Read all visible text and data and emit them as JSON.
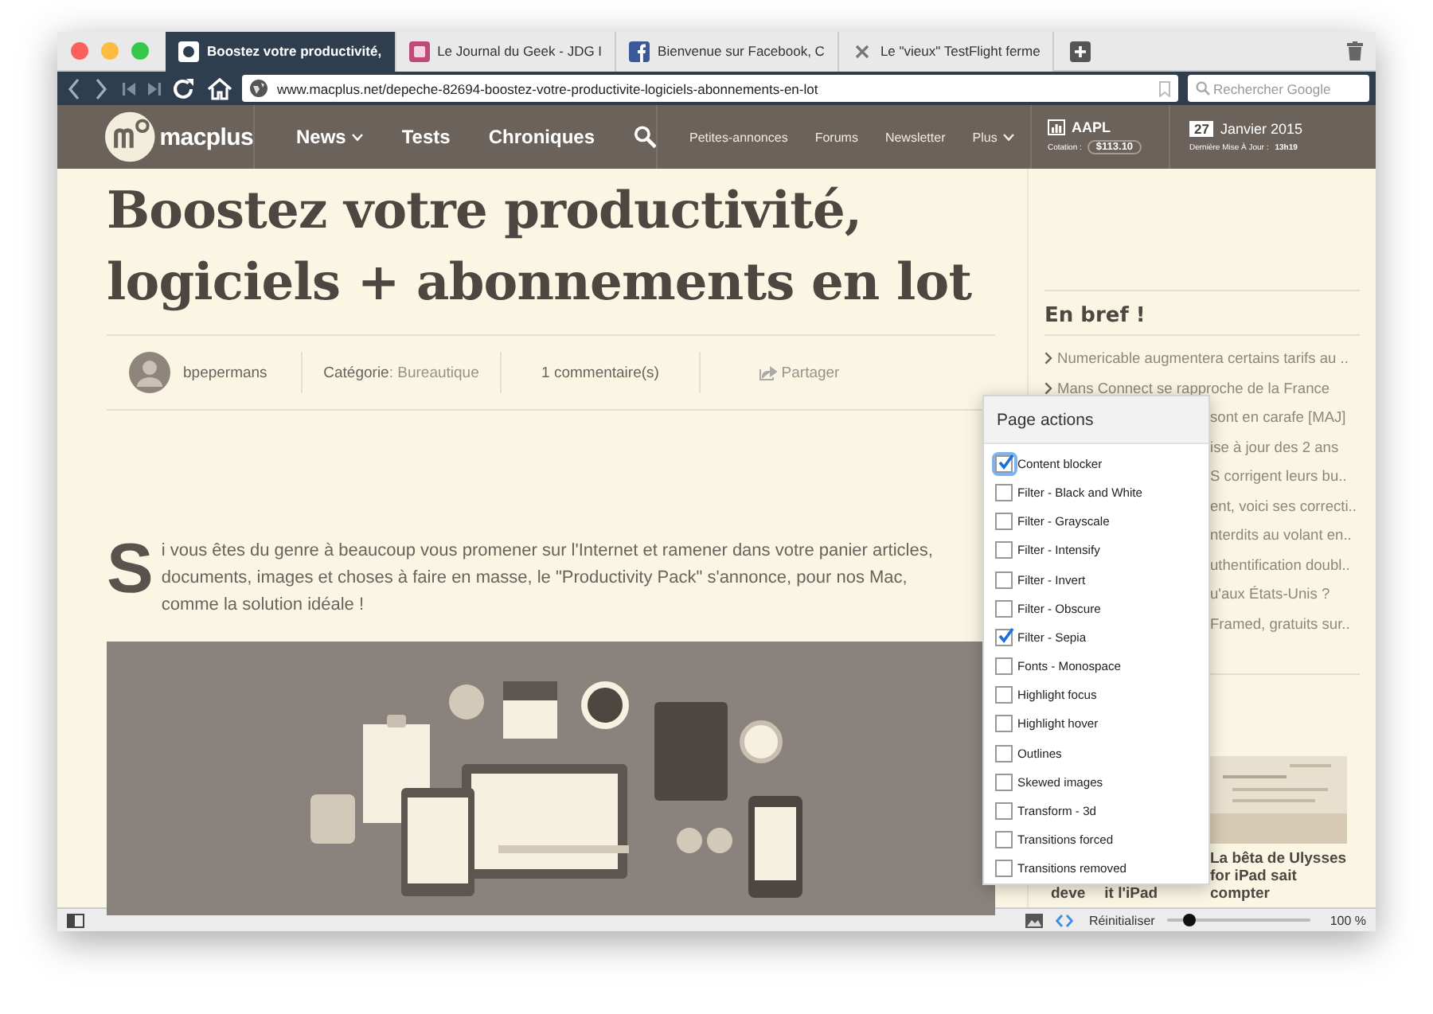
{
  "tabs": [
    {
      "label": "Boostez votre productivité,",
      "kind": "site",
      "selected": true
    },
    {
      "label": "Le Journal du Geek - JDG I",
      "kind": "journal",
      "selected": false
    },
    {
      "label": "Bienvenue sur Facebook, C",
      "kind": "facebook",
      "selected": false
    },
    {
      "label": "Le \"vieux\" TestFlight ferme",
      "kind": "close",
      "selected": false
    }
  ],
  "toolbar": {
    "url": "www.macplus.net/depeche-82694-boostez-votre-productivite-logiciels-abonnements-en-lot",
    "search": {
      "placeholder": "Rechercher Google"
    }
  },
  "site_header": {
    "logo": "macplus",
    "nav": [
      {
        "label": "News",
        "dropdown": true
      },
      {
        "label": "Tests",
        "dropdown": false
      },
      {
        "label": "Chroniques",
        "dropdown": false
      }
    ],
    "links": [
      {
        "label": "Petites-annonces",
        "dropdown": false
      },
      {
        "label": "Forums",
        "dropdown": false
      },
      {
        "label": "Newsletter",
        "dropdown": false
      },
      {
        "label": "Plus",
        "dropdown": true
      }
    ],
    "stock": {
      "symbol": "AAPL",
      "label": "Cotation :",
      "price": "$113.10"
    },
    "date": {
      "day": "27",
      "month": "Janvier 2015",
      "update_label": "Dernière Mise À Jour :",
      "update_time": "13h19"
    }
  },
  "article": {
    "title_lines": [
      "Boostez votre productivité,",
      "logiciels + abonnements en lot"
    ],
    "author": "bpepermans",
    "category_label": "Catégorie",
    "category": ": Bureautique",
    "comments": "1 commentaire(s)",
    "share": "Partager",
    "drop_cap": "S",
    "intro": "i vous êtes du genre à beaucoup vous promener sur l'Internet et ramener dans votre panier articles, documents, images et choses à faire en masse, le \"Productivity Pack\" s'annonce, pour nos Mac, comme la solution idéale !"
  },
  "sidebar": {
    "heading": "En bref !",
    "news": [
      {
        "text": "Numericable augmentera certains tarifs au ..",
        "kind": "full"
      },
      {
        "text": "Mans Connect se rapproche de la France",
        "kind": "full"
      },
      {
        "text": "sont en carafe [MAJ]",
        "kind": "covered"
      },
      {
        "text": "ise à jour des 2 ans",
        "kind": "covered"
      },
      {
        "text": "S corrigent leurs bu..",
        "kind": "covered"
      },
      {
        "text": "ent, voici ses correcti..",
        "kind": "covered"
      },
      {
        "text": "nterdits au volant en..",
        "kind": "covered"
      },
      {
        "text": "uthentification doubl..",
        "kind": "covered"
      },
      {
        "text": "u'aux États-Unis ?",
        "kind": "covered"
      },
      {
        "text": "Framed, gratuits sur..",
        "kind": "covered"
      }
    ],
    "cards": [
      {
        "title_parts": [
          "deve",
          "it l'iPad"
        ],
        "kind": "covered"
      },
      {
        "title_parts": [
          "La bêta de Ulysses for iPad sait compter"
        ],
        "kind": "picture"
      }
    ]
  },
  "popup": {
    "title": "Page actions",
    "items": [
      {
        "label": "Content blocker",
        "checked": true,
        "focused": true
      },
      {
        "label": "Filter - Black and White",
        "checked": false,
        "focused": false
      },
      {
        "label": "Filter - Grayscale",
        "checked": false,
        "focused": false
      },
      {
        "label": "Filter - Intensify",
        "checked": false,
        "focused": false
      },
      {
        "label": "Filter - Invert",
        "checked": false,
        "focused": false
      },
      {
        "label": "Filter - Obscure",
        "checked": false,
        "focused": false
      },
      {
        "label": "Filter - Sepia",
        "checked": true,
        "focused": false
      },
      {
        "label": "Fonts - Monospace",
        "checked": false,
        "focused": false
      },
      {
        "label": "Highlight focus",
        "checked": false,
        "focused": false
      },
      {
        "label": "Highlight hover",
        "checked": false,
        "focused": false
      },
      {
        "label": "Outlines",
        "checked": false,
        "focused": false
      },
      {
        "label": "Skewed images",
        "checked": false,
        "focused": false
      },
      {
        "label": "Transform - 3d",
        "checked": false,
        "focused": false
      },
      {
        "label": "Transitions forced",
        "checked": false,
        "focused": false
      },
      {
        "label": "Transitions removed",
        "checked": false,
        "focused": false
      }
    ]
  },
  "status_bar": {
    "reset": "Réinitialiser",
    "zoom": {
      "level": 0.15
    },
    "zoom_reading": "100 %"
  }
}
